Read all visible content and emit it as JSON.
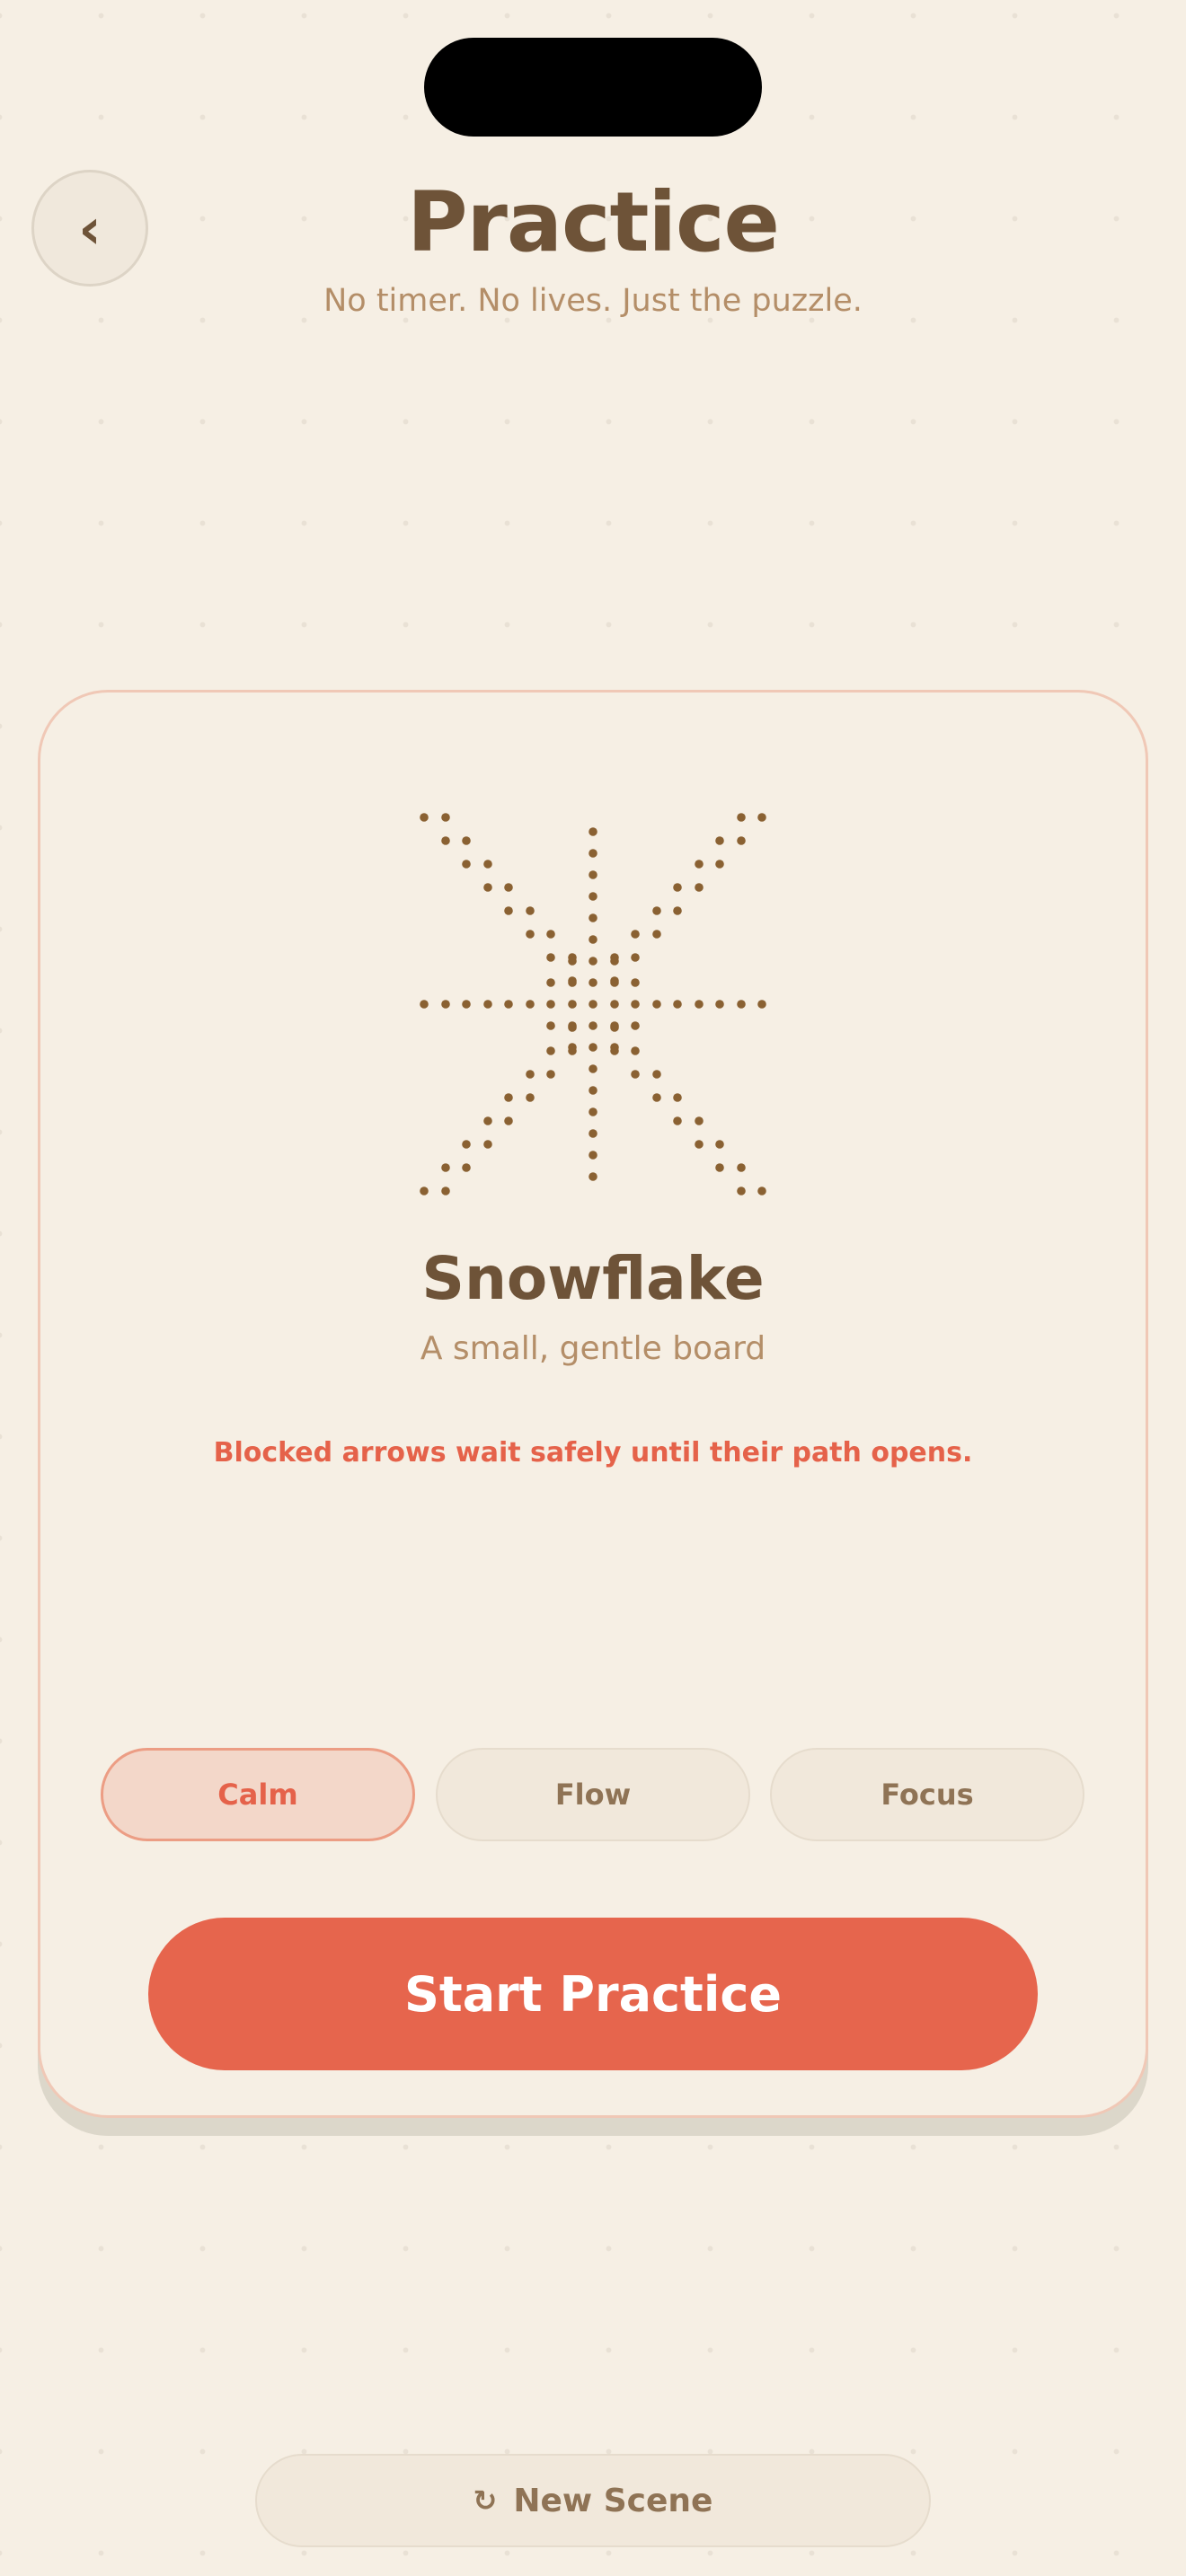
{
  "header": {
    "back_icon": "chevron-left-icon",
    "back_glyph": "‹",
    "title": "Practice",
    "subtitle": "No timer. No lives. Just the puzzle."
  },
  "card": {
    "scene_icon": "snowflake-dot-grid-icon",
    "scene_title": "Snowflake",
    "scene_subtitle": "A small, gentle board",
    "hint": "Blocked arrows wait safely until their path opens.",
    "modes": [
      {
        "label": "Calm",
        "selected": true
      },
      {
        "label": "Flow",
        "selected": false
      },
      {
        "label": "Focus",
        "selected": false
      }
    ],
    "start_label": "Start Practice"
  },
  "footer": {
    "refresh_icon": "refresh-icon",
    "refresh_glyph": "↻",
    "new_scene_label": "New Scene"
  },
  "colors": {
    "background": "#f6efe4",
    "title": "#6e5338",
    "muted": "#b48e68",
    "accent": "#e6654d",
    "dot": "#8a6132"
  }
}
